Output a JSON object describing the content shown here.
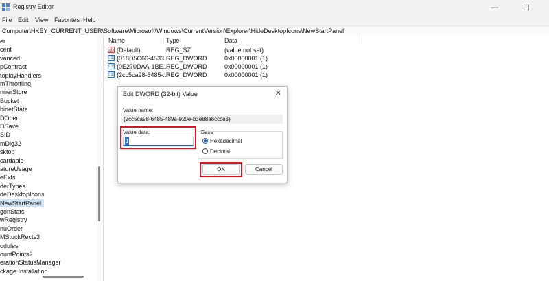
{
  "window": {
    "title": "Registry Editor",
    "minimize_glyph": "—",
    "maximize_glyph": "☐"
  },
  "menu": [
    "File",
    "Edit",
    "View",
    "Favorites",
    "Help"
  ],
  "address": "Computer\\HKEY_CURRENT_USER\\Software\\Microsoft\\Windows\\CurrentVersion\\Explorer\\HideDesktopIcons\\NewStartPanel",
  "tree": {
    "items": [
      "er",
      "cent",
      "vanced",
      "pContract",
      "toplayHandlers",
      "mThrottling",
      "nnerStore",
      "Bucket",
      "binetState",
      "DOpen",
      "DSave",
      "SID",
      "mDlg32",
      "sktop",
      "cardable",
      "atureUsage",
      "eExts",
      "derTypes",
      "deDesktopIcons",
      "NewStartPanel",
      "gonStats",
      "wRegistry",
      "nuOrder",
      "MStuckRects3",
      "odules",
      "ountPoints2",
      "erationStatusManager",
      "ckage Installation"
    ],
    "selected_index": 19
  },
  "list": {
    "headers": {
      "name": "Name",
      "type": "Type",
      "data": "Data"
    },
    "rows": [
      {
        "icon": "ab",
        "name": "(Default)",
        "type": "REG_SZ",
        "data": "(value not set)"
      },
      {
        "icon": "011",
        "name": "{018D5C66-4533...",
        "type": "REG_DWORD",
        "data": "0x00000001 (1)"
      },
      {
        "icon": "011",
        "name": "{0E270DAA-1BE...",
        "type": "REG_DWORD",
        "data": "0x00000001 (1)"
      },
      {
        "icon": "011",
        "name": "{2cc5ca98-6485-...",
        "type": "REG_DWORD",
        "data": "0x00000001 (1)"
      }
    ]
  },
  "dialog": {
    "title": "Edit DWORD (32-bit) Value",
    "close_glyph": "✕",
    "value_name_label": "Value name:",
    "value_name": "{2cc5ca98-6485-489a-920e-b3e88a6ccce3}",
    "value_data_label": "Value data:",
    "value_data": "1",
    "base_label": "Base",
    "hex_label": "Hexadecimal",
    "dec_label": "Decimal",
    "base_selected": "Hexadecimal",
    "ok_label": "OK",
    "cancel_label": "Cancel"
  },
  "colors": {
    "highlight": "#d9161c",
    "selection": "#cce4f7",
    "accent": "#1f5fb4"
  }
}
